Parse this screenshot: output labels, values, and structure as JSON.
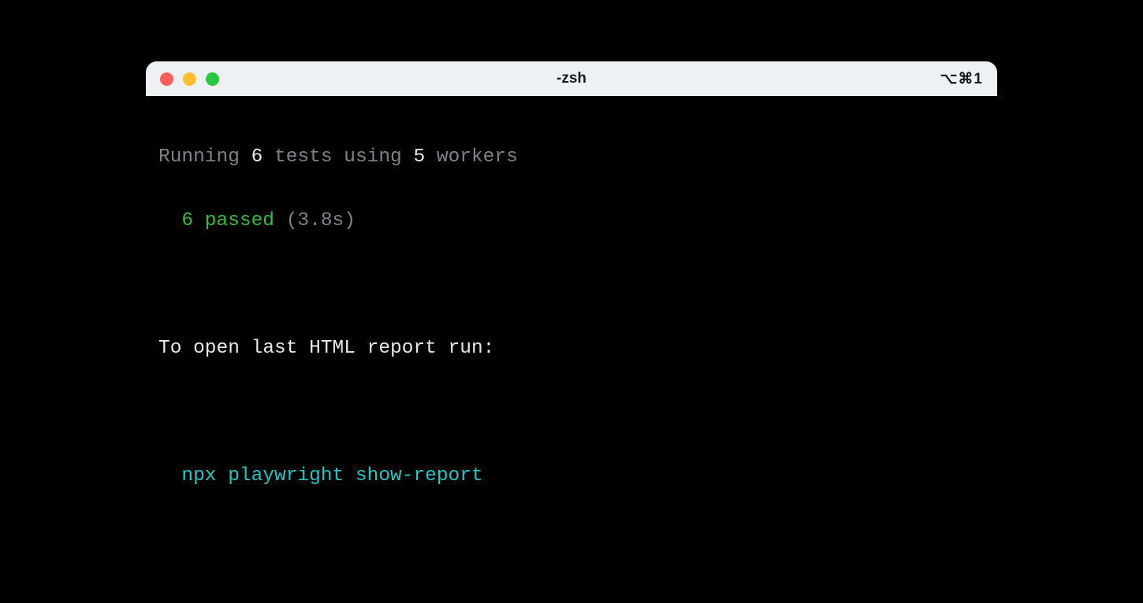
{
  "window": {
    "title": "-zsh",
    "shortcut": "⌥⌘1"
  },
  "output": {
    "line1": {
      "prefix": "Running ",
      "tests_count": "6",
      "mid": " tests using ",
      "workers_count": "5",
      "suffix": " workers"
    },
    "line2": {
      "passed": "6 passed",
      "duration": " (3.8s)"
    },
    "line3": "To open last HTML report run:",
    "line4": "npx playwright show-report"
  }
}
